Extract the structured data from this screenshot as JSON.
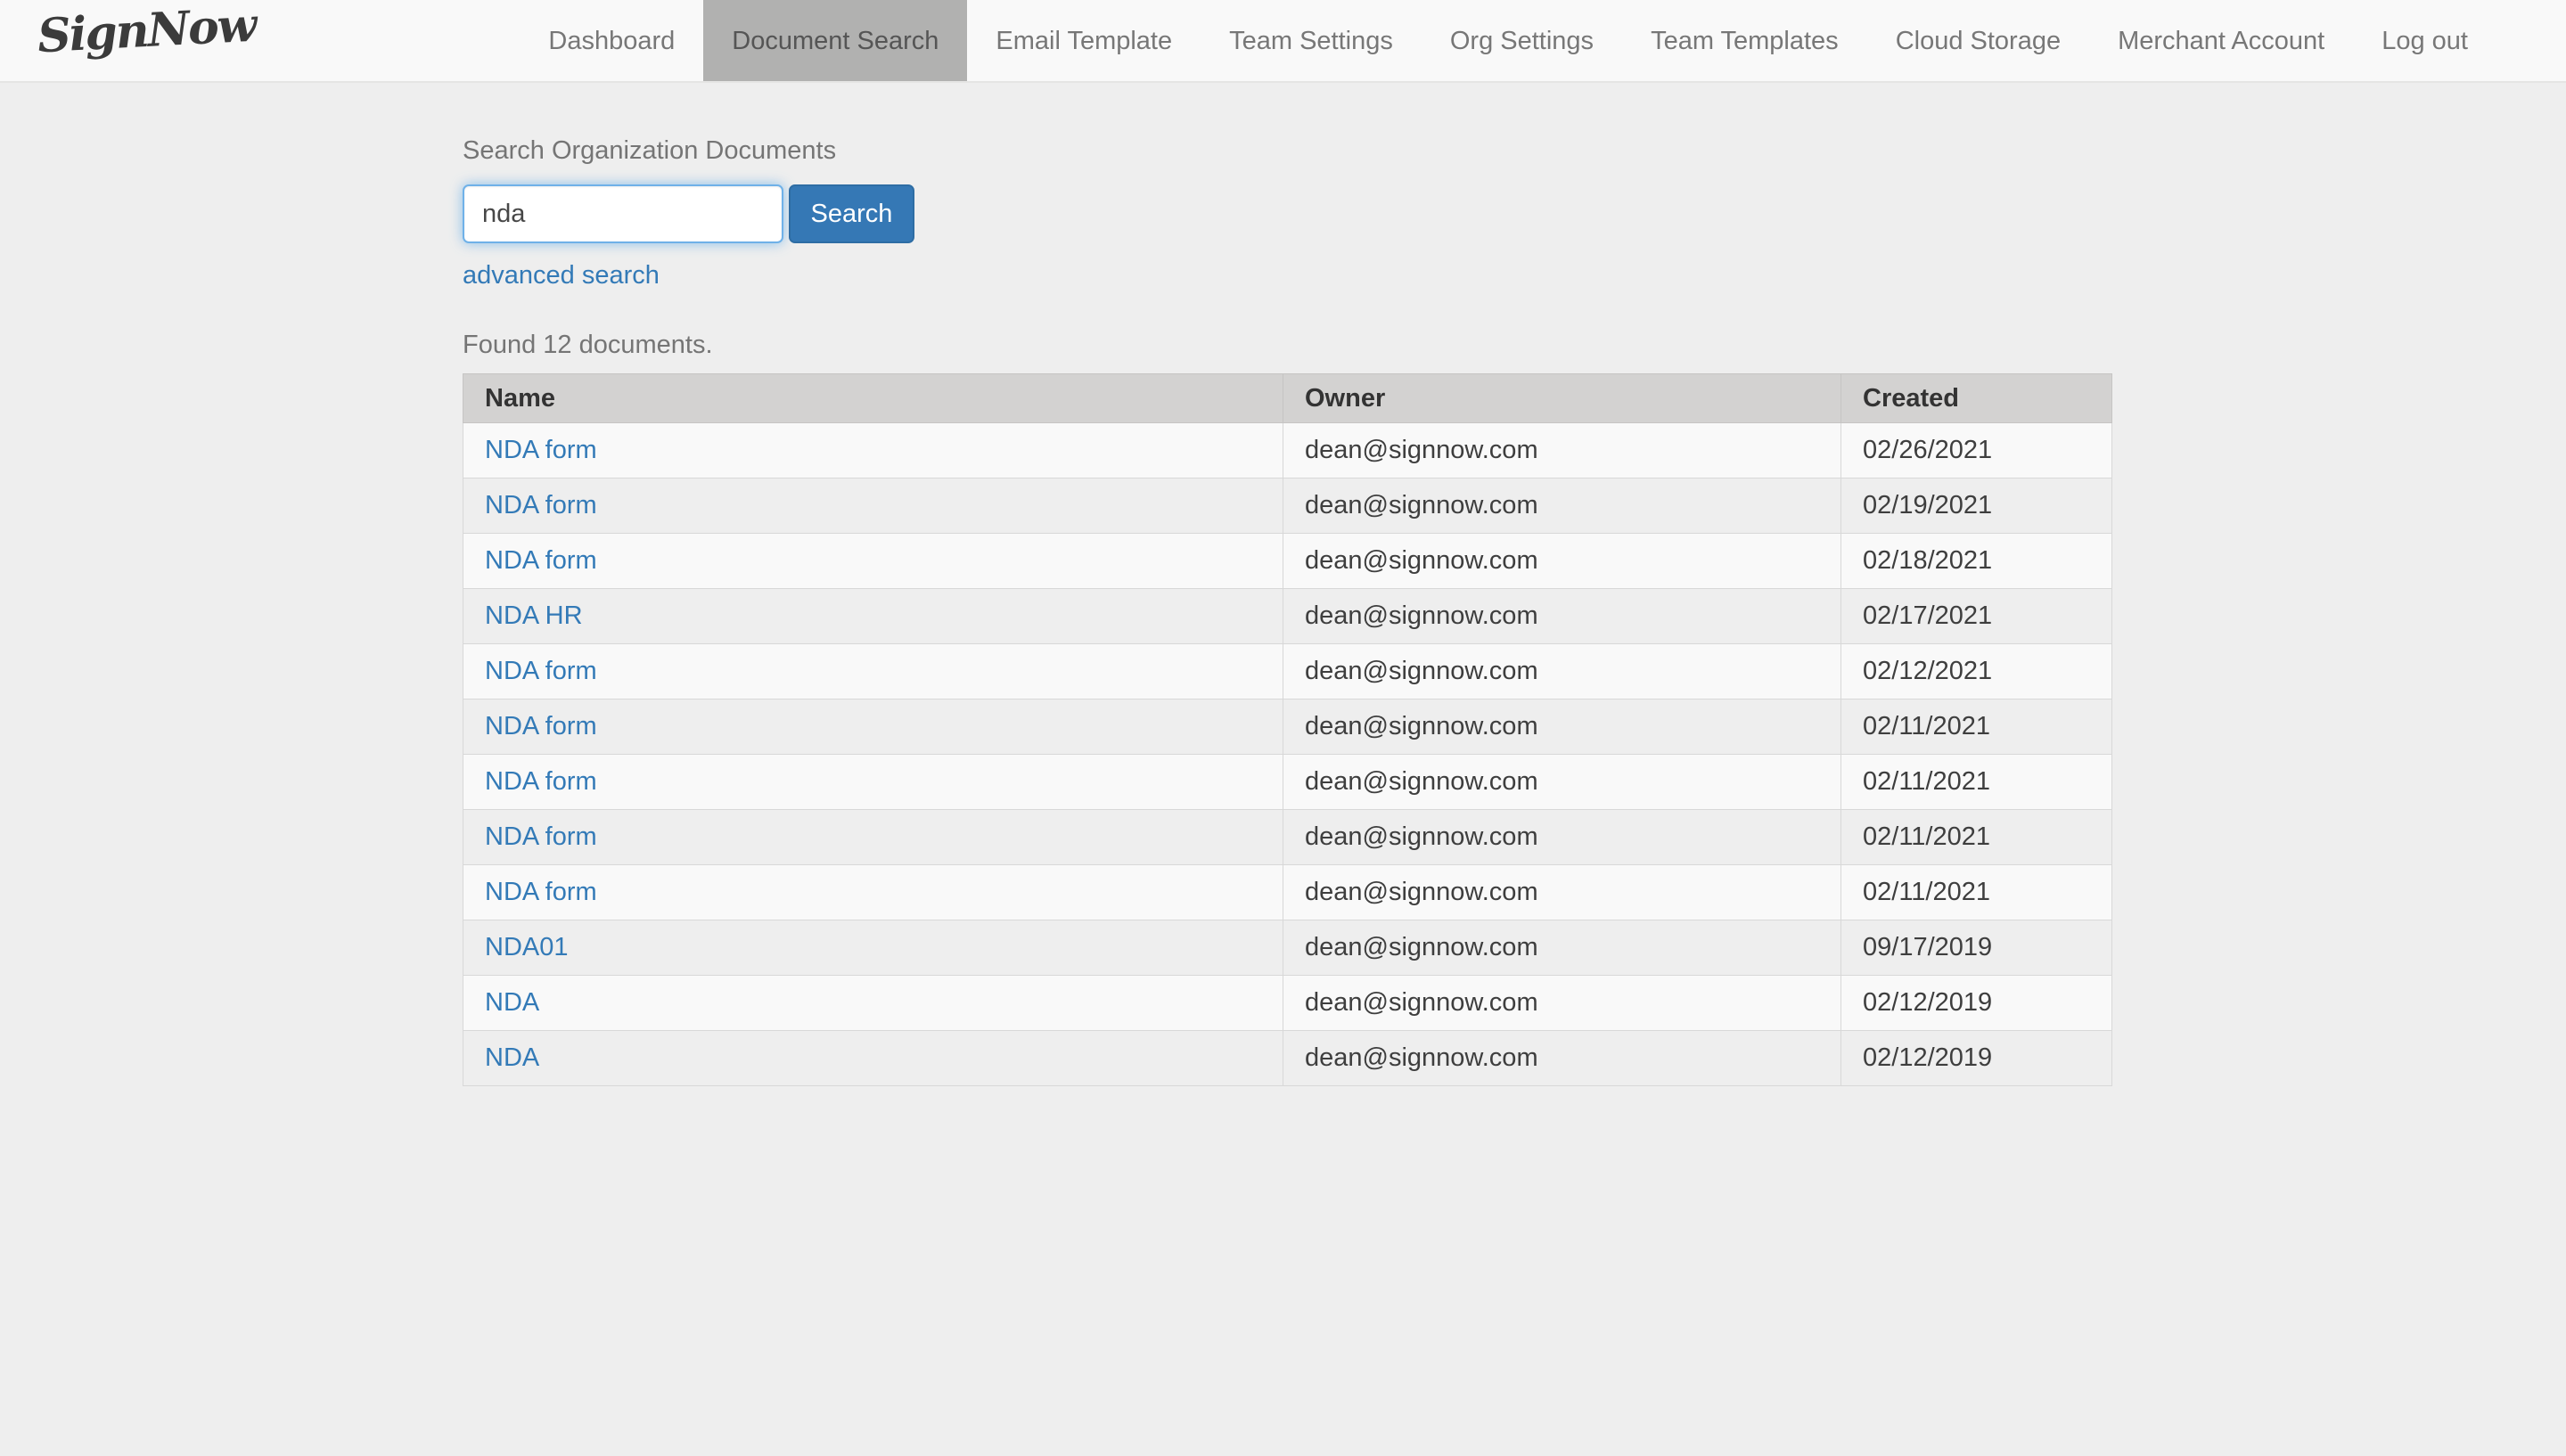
{
  "brand": {
    "logo_text": "SignNow"
  },
  "nav": {
    "items": [
      {
        "label": "Dashboard",
        "active": false
      },
      {
        "label": "Document Search",
        "active": true
      },
      {
        "label": "Email Template",
        "active": false
      },
      {
        "label": "Team Settings",
        "active": false
      },
      {
        "label": "Org Settings",
        "active": false
      },
      {
        "label": "Team Templates",
        "active": false
      },
      {
        "label": "Cloud Storage",
        "active": false
      },
      {
        "label": "Merchant Account",
        "active": false
      },
      {
        "label": "Log out",
        "active": false
      }
    ]
  },
  "search": {
    "label": "Search Organization Documents",
    "query": "nda",
    "button_label": "Search",
    "advanced_link": "advanced search"
  },
  "results": {
    "summary": "Found 12 documents.",
    "table": {
      "columns": [
        "Name",
        "Owner",
        "Created"
      ],
      "rows": [
        {
          "name": "NDA form",
          "owner": "dean@signnow.com",
          "created": "02/26/2021"
        },
        {
          "name": "NDA form",
          "owner": "dean@signnow.com",
          "created": "02/19/2021"
        },
        {
          "name": "NDA form",
          "owner": "dean@signnow.com",
          "created": "02/18/2021"
        },
        {
          "name": "NDA HR",
          "owner": "dean@signnow.com",
          "created": "02/17/2021"
        },
        {
          "name": "NDA form",
          "owner": "dean@signnow.com",
          "created": "02/12/2021"
        },
        {
          "name": "NDA form",
          "owner": "dean@signnow.com",
          "created": "02/11/2021"
        },
        {
          "name": "NDA form",
          "owner": "dean@signnow.com",
          "created": "02/11/2021"
        },
        {
          "name": "NDA form",
          "owner": "dean@signnow.com",
          "created": "02/11/2021"
        },
        {
          "name": "NDA form",
          "owner": "dean@signnow.com",
          "created": "02/11/2021"
        },
        {
          "name": "NDA01",
          "owner": "dean@signnow.com",
          "created": "09/17/2019"
        },
        {
          "name": "NDA",
          "owner": "dean@signnow.com",
          "created": "02/12/2019"
        },
        {
          "name": "NDA",
          "owner": "dean@signnow.com",
          "created": "02/12/2019"
        }
      ]
    }
  },
  "colors": {
    "accent_blue": "#337ab7",
    "button_bg": "#3578b5",
    "button_border": "#2e6da4",
    "input_focus_border": "#6fb1e8",
    "navbar_bg": "#f9f9f9",
    "active_tab_bg": "#b1b1b0",
    "page_bg": "#eeeeee",
    "table_header_bg": "#d3d2d1",
    "row_odd_bg": "#f9f9f9",
    "row_even_bg": "#eeeeee"
  }
}
